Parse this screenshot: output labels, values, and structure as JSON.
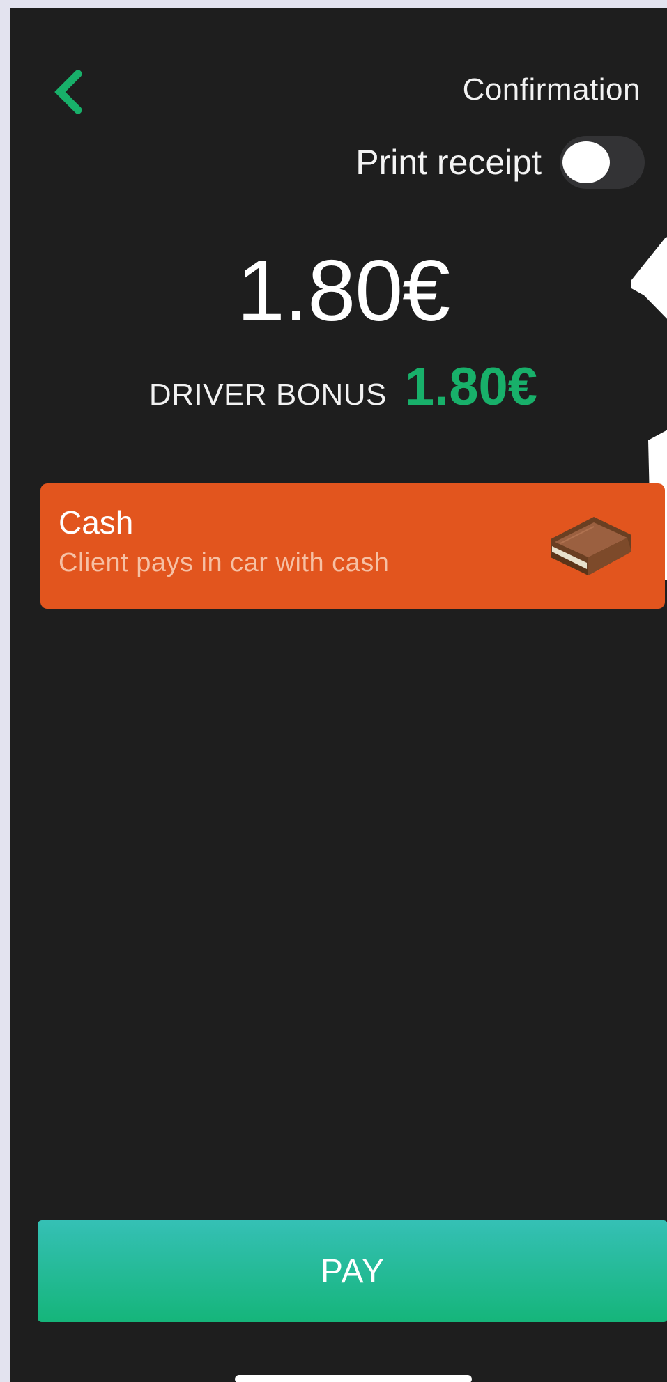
{
  "header": {
    "back_icon": "chevron-left-icon",
    "title": "Confirmation"
  },
  "receipt": {
    "label": "Print receipt",
    "enabled": false
  },
  "amount": {
    "total": "1.80€"
  },
  "bonus": {
    "label": "DRIVER BONUS",
    "value": "1.80€"
  },
  "payment_method": {
    "title": "Cash",
    "subtitle": "Client pays in car with cash",
    "icon": "wallet-icon"
  },
  "actions": {
    "pay_label": "PAY"
  },
  "colors": {
    "background": "#1e1e1e",
    "accent_green": "#18b06a",
    "cash_orange": "#e2551e",
    "pay_gradient_top": "#35c0b5",
    "pay_gradient_bottom": "#15b57a"
  }
}
